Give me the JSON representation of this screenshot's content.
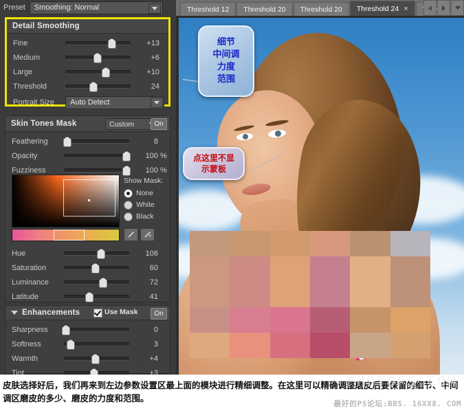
{
  "app": {
    "accent_highlight": "#f2e400",
    "panel_bg": "#3b3b3b"
  },
  "preset": {
    "label": "Preset",
    "value": "Smoothing: Normal"
  },
  "detail_smoothing": {
    "title": "Detail Smoothing",
    "sliders": [
      {
        "label": "Fine",
        "value": "+13",
        "pct": 70
      },
      {
        "label": "Medium",
        "value": "+6",
        "pct": 48
      },
      {
        "label": "Large",
        "value": "+10",
        "pct": 61
      },
      {
        "label": "Threshold",
        "value": "24",
        "pct": 42
      }
    ],
    "portrait_size": {
      "label": "Portrait Size",
      "value": "Auto Detect"
    }
  },
  "skin_tones_mask": {
    "title": "Skin Tones Mask",
    "preset": "Custom",
    "toggle": "On",
    "sliders": [
      {
        "label": "Feathering",
        "value": "8",
        "unit": "",
        "pct": 4
      },
      {
        "label": "Opacity",
        "value": "100",
        "unit": "%",
        "pct": 95
      },
      {
        "label": "Fuzziness",
        "value": "100",
        "unit": "%",
        "pct": 95
      }
    ],
    "show_mask": {
      "title": "Show Mask:",
      "options": [
        "None",
        "White",
        "Black"
      ],
      "selected": "None"
    },
    "tools": [
      "eyedropper-icon",
      "eyedropper-add-icon"
    ],
    "color_sliders": [
      {
        "label": "Hue",
        "value": "106",
        "pct": 56
      },
      {
        "label": "Saturation",
        "value": "60",
        "pct": 47
      },
      {
        "label": "Luminance",
        "value": "72",
        "pct": 59
      },
      {
        "label": "Latitude",
        "value": "41",
        "pct": 38
      }
    ]
  },
  "enhancements": {
    "title": "Enhancements",
    "use_mask_label": "Use Mask",
    "use_mask_checked": true,
    "toggle": "On",
    "sliders": [
      {
        "label": "Sharpness",
        "value": "0",
        "pct": 2
      },
      {
        "label": "Softness",
        "value": "3",
        "pct": 9
      },
      {
        "label": "Warmth",
        "value": "+4",
        "pct": 47
      },
      {
        "label": "Tint",
        "value": "+3",
        "pct": 45
      }
    ]
  },
  "tabs": {
    "items": [
      {
        "label": "Threshold 12",
        "active": false,
        "closable": false
      },
      {
        "label": "Threshold 20",
        "active": false,
        "closable": false
      },
      {
        "label": "Threshold 20",
        "active": false,
        "closable": false
      },
      {
        "label": "Threshold 24",
        "active": true,
        "closable": true
      },
      {
        "label": "Thresho",
        "active": false,
        "closable": false
      }
    ],
    "close_glyph": "×",
    "nav": [
      "prev-tab-button",
      "next-tab-button",
      "tab-list-button"
    ]
  },
  "callouts": [
    {
      "id": "callout-detail",
      "lines": [
        "细节",
        "中间调",
        "力度",
        "范围"
      ],
      "color": "#1a27c8"
    },
    {
      "id": "callout-mask",
      "lines": [
        "点这里不显",
        "示蒙板"
      ],
      "color": "#c50b12"
    }
  ],
  "caption": {
    "text": "皮肤选择好后，我们再来到左边参数设置区最上面的模块进行精细调整。在这里可以精确调整磨皮后要保留的细节、中间调区磨皮的多少、磨皮的力度和范围。",
    "watermark": "最好的PS论坛:BBS. 16XX8. COM",
    "watermark_big": "PHOTOPS.COM"
  },
  "mosaic": {
    "cols": 6,
    "rows": 5,
    "colors": [
      "#c4997b",
      "#c99870",
      "#d09a6d",
      "#d8987e",
      "#bc9170",
      "#b8b4bb",
      "#cb9880",
      "#cd8b85",
      "#dda276",
      "#c4808f",
      "#e2b087",
      "#bd9279",
      "#cb9880",
      "#cd8b85",
      "#dda276",
      "#c4808f",
      "#e2b087",
      "#bd9279",
      "#c69086",
      "#d77f90",
      "#d9758f",
      "#b85e74",
      "#c59468",
      "#dca268",
      "#dfa97f",
      "#e8927e",
      "#d6707f",
      "#b84e6a",
      "#c9a588",
      "#d4a070"
    ]
  }
}
